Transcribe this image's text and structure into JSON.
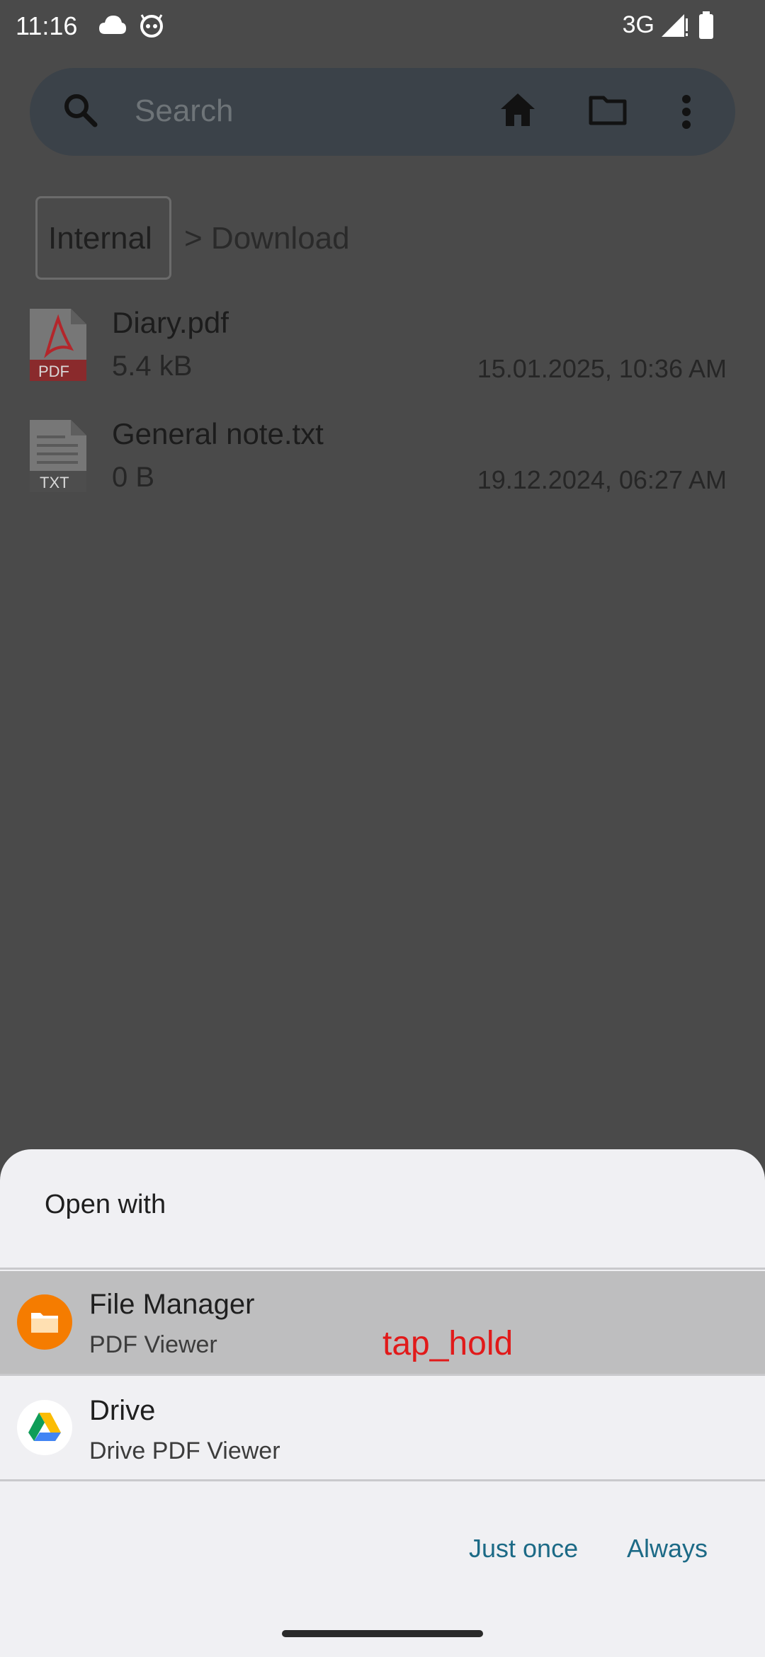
{
  "status_bar": {
    "time": "11:16",
    "network": "3G",
    "icons": [
      "cloud-icon",
      "face-icon",
      "signal-icon",
      "battery-icon"
    ]
  },
  "search": {
    "placeholder": "Search",
    "icons": [
      "search-icon",
      "home-icon",
      "folder-icon",
      "more-vert-icon"
    ]
  },
  "breadcrumb": {
    "root": "Internal",
    "path": "> Download"
  },
  "files": [
    {
      "name": "Diary.pdf",
      "size": "5.4 kB",
      "date": "15.01.2025, 10:36 AM",
      "icon": "pdf-file-icon",
      "badge": "PDF"
    },
    {
      "name": "General note.txt",
      "size": "0 B",
      "date": "19.12.2024, 06:27 AM",
      "icon": "txt-file-icon",
      "badge": "TXT"
    }
  ],
  "open_with": {
    "title": "Open with",
    "apps": [
      {
        "name": "File Manager",
        "subtitle": "PDF Viewer",
        "icon": "file-manager-icon"
      },
      {
        "name": "Drive",
        "subtitle": "Drive PDF Viewer",
        "icon": "google-drive-icon"
      }
    ],
    "overlay_label": "tap_hold",
    "buttons": {
      "just_once": "Just once",
      "always": "Always"
    }
  },
  "colors": {
    "scrim": "#4a4a4a",
    "sheet": "#f0f0f3",
    "selected_row": "#bebebf",
    "accent_text": "#1c6a86",
    "file_manager_orange": "#f57c00",
    "pdf_red": "#b3262b",
    "overlay_red": "#e11a1a"
  }
}
